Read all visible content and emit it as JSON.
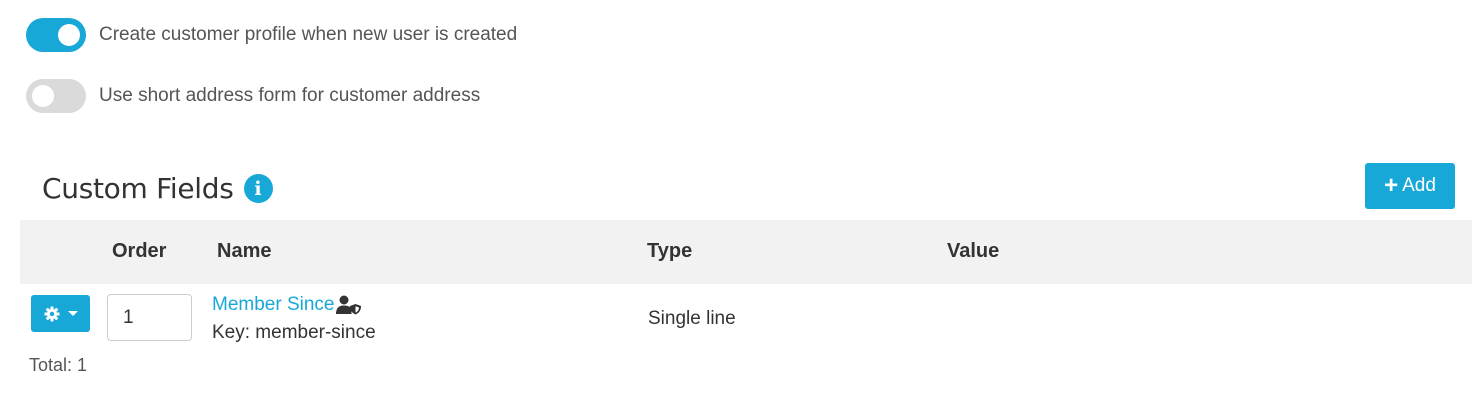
{
  "settings": {
    "create_profile": {
      "label": "Create customer profile when new user is created",
      "enabled": true
    },
    "short_address": {
      "label": "Use short address form for customer address",
      "enabled": false
    }
  },
  "custom_fields": {
    "title": "Custom Fields",
    "info_icon": "info-circle-icon",
    "add_label": "Add",
    "columns": {
      "order": "Order",
      "name": "Name",
      "type": "Type",
      "value": "Value"
    },
    "rows": [
      {
        "order": "1",
        "name": "Member Since",
        "key_text": "Key: member-since",
        "type": "Single line",
        "value": "",
        "icons": [
          "gear-icon",
          "user-shield-icon"
        ]
      }
    ],
    "total_text": "Total: 1"
  },
  "colors": {
    "accent": "#18a8d8",
    "toggle_off": "#dadada",
    "header_bg": "#f2f2f2"
  }
}
